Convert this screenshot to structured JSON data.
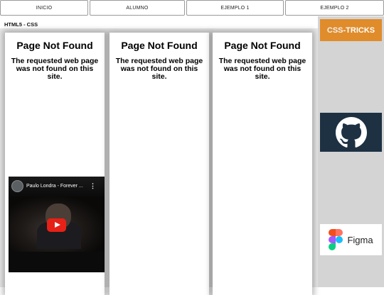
{
  "nav": {
    "items": [
      {
        "label": "INICIO"
      },
      {
        "label": "ALUMNO"
      },
      {
        "label": "EJEMPLO 1"
      },
      {
        "label": "EJEMPLO 2"
      }
    ]
  },
  "page": {
    "subtitle": "HTML5 - CSS"
  },
  "panels": [
    {
      "heading": "Page Not Found",
      "message": "The requested web page was not found on this site."
    },
    {
      "heading": "Page Not Found",
      "message": "The requested web page was not found on this site."
    },
    {
      "heading": "Page Not Found",
      "message": "The requested web page was not found on this site."
    }
  ],
  "video": {
    "title": "Paulo Londra - Forever ...",
    "menu": "⋮"
  },
  "sidebar": {
    "css_tricks": {
      "part1": "CSS",
      "part2": "-TRICKS"
    },
    "github": {
      "icon": "github-icon"
    },
    "figma": {
      "label": "Figma",
      "icon": "figma-icon"
    }
  },
  "colors": {
    "css_tricks_bg": "#e08c2b",
    "github_bg": "#1d3143",
    "sidebar_bg": "#d4d4d4",
    "play_button": "#e62117"
  }
}
